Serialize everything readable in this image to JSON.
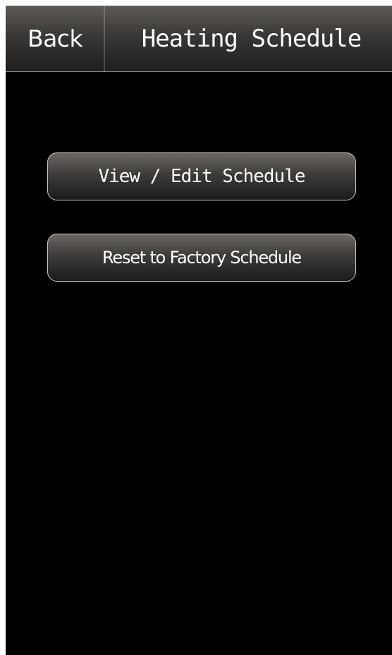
{
  "header": {
    "back_label": "Back",
    "title": "Heating Schedule"
  },
  "menu": {
    "items": [
      {
        "label": "View / Edit Schedule"
      },
      {
        "label": "Reset to Factory Schedule"
      }
    ]
  },
  "colors": {
    "background": "#000000",
    "header_gradient_top": "#5e5b59",
    "header_gradient_bottom": "#1f1e1d",
    "button_border": "#c9c7c5",
    "text": "#ffffff"
  }
}
